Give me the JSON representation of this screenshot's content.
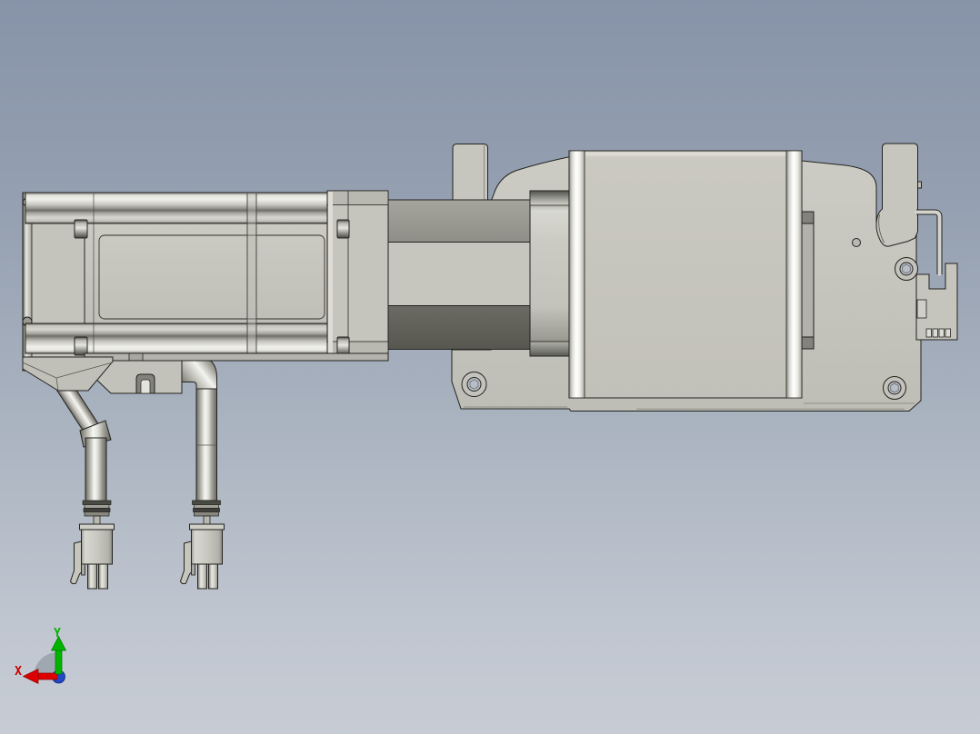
{
  "viewport": {
    "type": "3d-cad-side-view",
    "description": "Side view of a motorized miniature linear slide actuator: stepper motor with gearbox flange on the left, shaft coupling housing, slider carriage on a base plate on the right, sensor bracket with wire, and two motor cables ending in 4-pin connectors",
    "background_top": "#8793a8",
    "background_bottom": "#c7ccd4"
  },
  "model": {
    "part_color": "#c7c7bf",
    "outline_color": "#23231f",
    "coupling_band_mid": "#9b9b93",
    "coupling_band_dark": "#5f5f58",
    "highlight_color": "#ffffff",
    "parts": [
      {
        "name": "stepper-motor"
      },
      {
        "name": "motor-gearbox-flange"
      },
      {
        "name": "coupling-housing"
      },
      {
        "name": "slider-carriage"
      },
      {
        "name": "base-plate"
      },
      {
        "name": "linear-rail"
      },
      {
        "name": "sensor-bracket"
      },
      {
        "name": "end-stop-tab-left"
      },
      {
        "name": "end-stop-hook-right"
      },
      {
        "name": "sensor-wire"
      },
      {
        "name": "mounting-bracket"
      },
      {
        "name": "motor-cable"
      },
      {
        "name": "encoder-cable"
      },
      {
        "name": "cable-connector-left"
      },
      {
        "name": "cable-connector-right"
      }
    ]
  },
  "axis_triad": {
    "x_label": "X",
    "y_label": "Y",
    "x_color": "#d40000",
    "y_color": "#00b400",
    "z_color": "#2148c8",
    "disc_color": "#9ba3ad"
  }
}
